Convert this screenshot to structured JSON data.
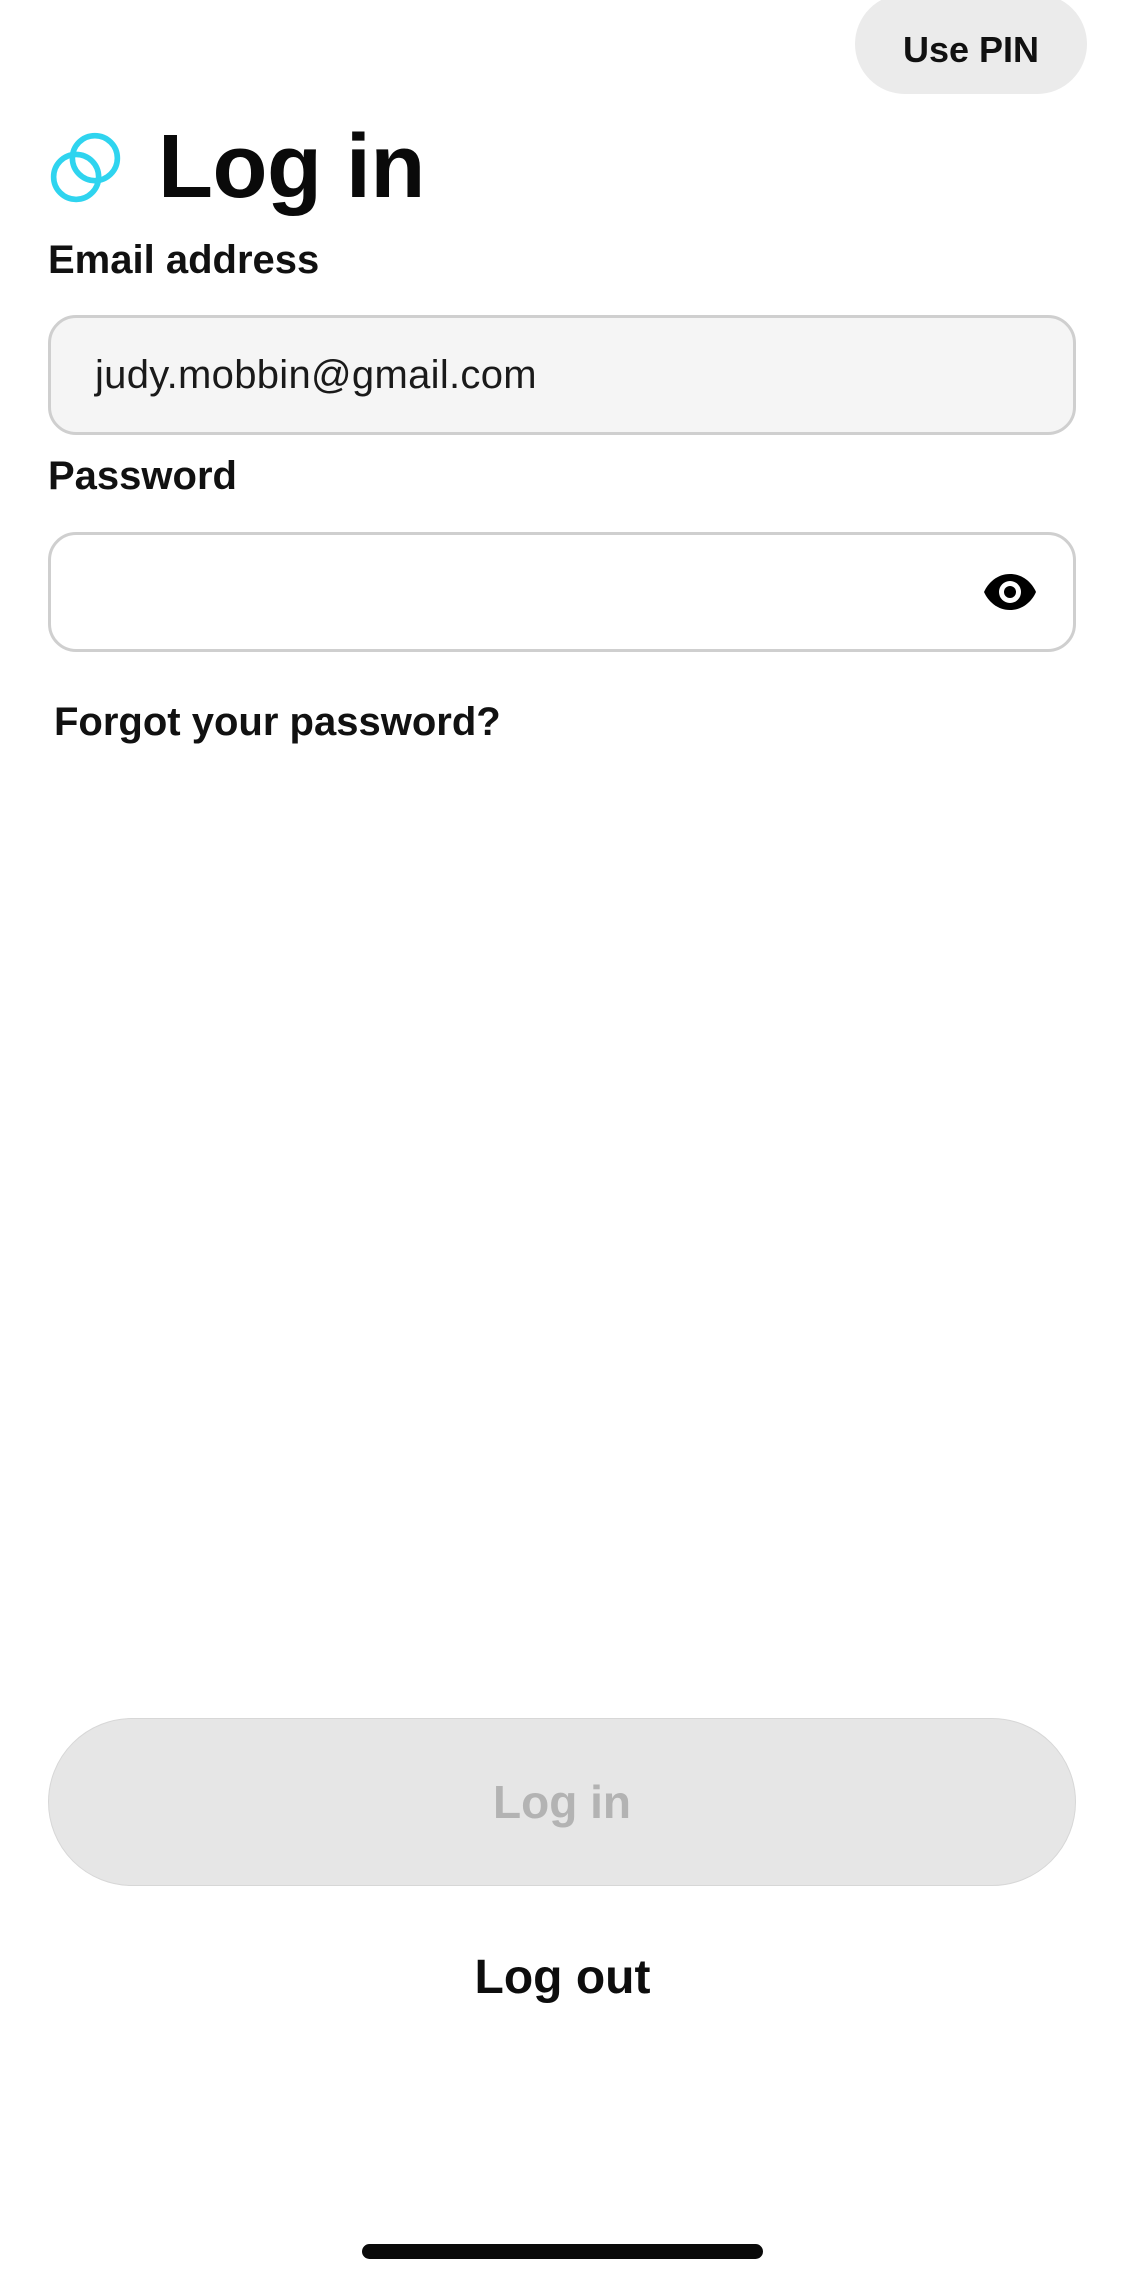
{
  "header": {
    "pin_button_label": "Use PIN",
    "title": "Log in",
    "logo_icon": "gemini-logo-icon"
  },
  "form": {
    "email": {
      "label": "Email address",
      "value": "judy.mobbin@gmail.com"
    },
    "password": {
      "label": "Password",
      "value": "",
      "toggle_icon": "eye-icon"
    },
    "forgot_link": "Forgot your password?"
  },
  "actions": {
    "login_label": "Log in",
    "logout_label": "Log out"
  },
  "colors": {
    "accent": "#2fd4ef",
    "disabled_button_bg": "#e6e6e6",
    "disabled_button_text": "#b3b3b3",
    "email_field_bg": "#f5f5f5",
    "pin_button_bg": "#ebebeb"
  }
}
